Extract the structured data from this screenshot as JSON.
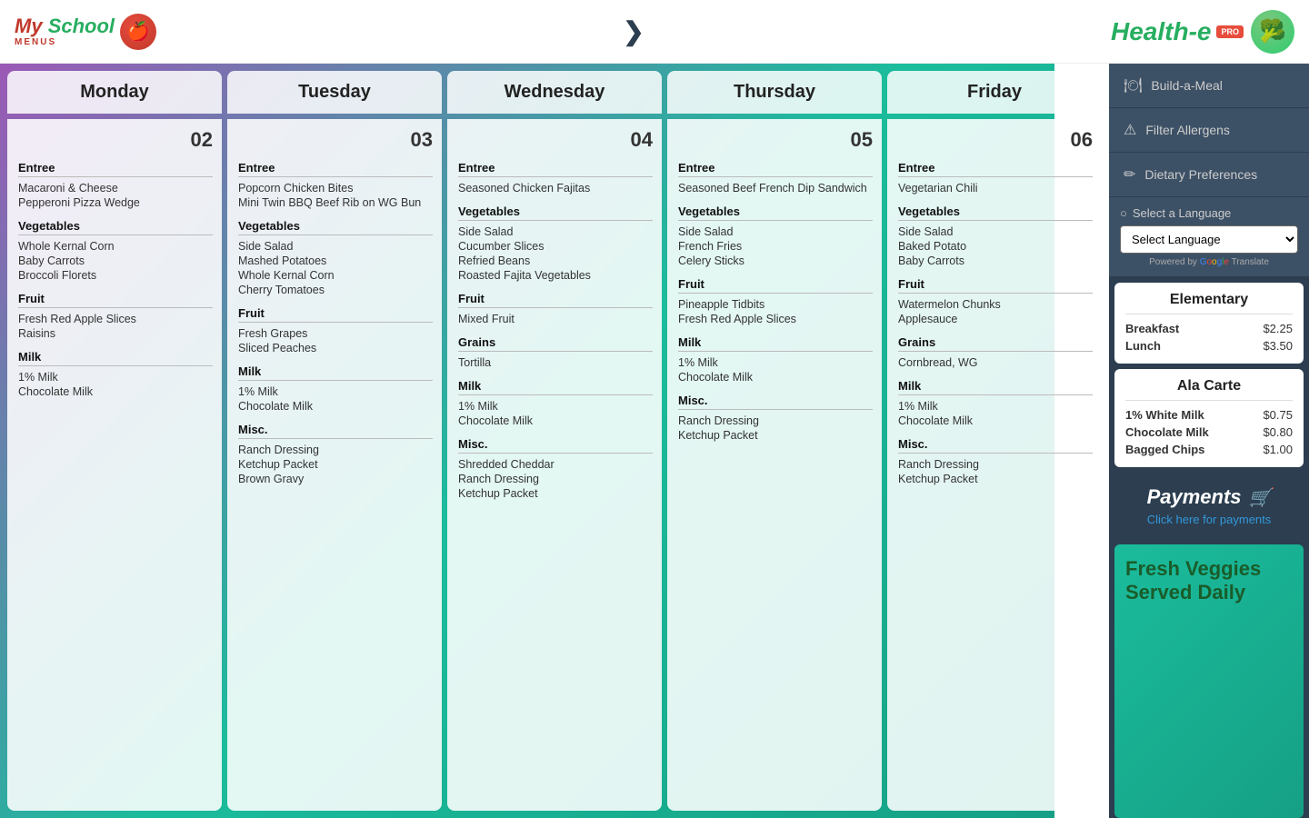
{
  "header": {
    "logo_left": "My School",
    "logo_sub": "MENUS",
    "logo_right_1": "Health",
    "logo_right_e": "e",
    "logo_right_bro": "BRo",
    "pro_badge": "PRO",
    "chevron": "❯"
  },
  "days": [
    {
      "name": "Monday",
      "num": "02",
      "sections": [
        {
          "title": "Entree",
          "items": [
            "Macaroni & Cheese",
            "Pepperoni Pizza Wedge"
          ]
        },
        {
          "title": "Vegetables",
          "items": [
            "Whole Kernal Corn",
            "Baby Carrots",
            "Broccoli Florets"
          ]
        },
        {
          "title": "Fruit",
          "items": [
            "Fresh Red Apple Slices",
            "Raisins"
          ]
        },
        {
          "title": "Milk",
          "items": [
            "1% Milk",
            "Chocolate Milk"
          ]
        }
      ]
    },
    {
      "name": "Tuesday",
      "num": "03",
      "sections": [
        {
          "title": "Entree",
          "items": [
            "Popcorn Chicken Bites",
            "Mini Twin BBQ Beef Rib on WG Bun"
          ]
        },
        {
          "title": "Vegetables",
          "items": [
            "Side Salad",
            "Mashed Potatoes",
            "Whole Kernal Corn",
            "Cherry Tomatoes"
          ]
        },
        {
          "title": "Fruit",
          "items": [
            "Fresh Grapes",
            "Sliced Peaches"
          ]
        },
        {
          "title": "Milk",
          "items": [
            "1% Milk",
            "Chocolate Milk"
          ]
        },
        {
          "title": "Misc.",
          "items": [
            "Ranch Dressing",
            "Ketchup Packet",
            "Brown Gravy"
          ]
        }
      ]
    },
    {
      "name": "Wednesday",
      "num": "04",
      "sections": [
        {
          "title": "Entree",
          "items": [
            "Seasoned Chicken Fajitas"
          ]
        },
        {
          "title": "Vegetables",
          "items": [
            "Side Salad",
            "Cucumber Slices",
            "Refried Beans",
            "Roasted Fajita Vegetables"
          ]
        },
        {
          "title": "Fruit",
          "items": [
            "Mixed Fruit"
          ]
        },
        {
          "title": "Grains",
          "items": [
            "Tortilla"
          ]
        },
        {
          "title": "Milk",
          "items": [
            "1% Milk",
            "Chocolate Milk"
          ]
        },
        {
          "title": "Misc.",
          "items": [
            "Shredded Cheddar",
            "Ranch Dressing",
            "Ketchup Packet"
          ]
        }
      ]
    },
    {
      "name": "Thursday",
      "num": "05",
      "sections": [
        {
          "title": "Entree",
          "items": [
            "Seasoned Beef French Dip Sandwich"
          ]
        },
        {
          "title": "Vegetables",
          "items": [
            "Side Salad",
            "French Fries",
            "Celery Sticks"
          ]
        },
        {
          "title": "Fruit",
          "items": [
            "Pineapple Tidbits",
            "Fresh Red Apple Slices"
          ]
        },
        {
          "title": "Milk",
          "items": [
            "1% Milk",
            "Chocolate Milk"
          ]
        },
        {
          "title": "Misc.",
          "items": [
            "Ranch Dressing",
            "Ketchup Packet"
          ]
        }
      ]
    },
    {
      "name": "Friday",
      "num": "06",
      "sections": [
        {
          "title": "Entree",
          "items": [
            "Vegetarian Chili"
          ]
        },
        {
          "title": "Vegetables",
          "items": [
            "Side Salad",
            "Baked Potato",
            "Baby Carrots"
          ]
        },
        {
          "title": "Fruit",
          "items": [
            "Watermelon Chunks",
            "Applesauce"
          ]
        },
        {
          "title": "Grains",
          "items": [
            "Cornbread, WG"
          ]
        },
        {
          "title": "Milk",
          "items": [
            "1% Milk",
            "Chocolate Milk"
          ]
        },
        {
          "title": "Misc.",
          "items": [
            "Ranch Dressing",
            "Ketchup Packet"
          ]
        }
      ]
    }
  ],
  "sidebar": {
    "build_meal": "Build-a-Meal",
    "filter_allergens": "Filter Allergens",
    "dietary_prefs": "Dietary Preferences",
    "select_lang_label": "Select a Language",
    "select_lang_placeholder": "Select Language",
    "powered_by": "Powered by",
    "google_translate": "Google Translate",
    "elementary_title": "Elementary",
    "breakfast_label": "Breakfast",
    "breakfast_price": "$2.25",
    "lunch_label": "Lunch",
    "lunch_price": "$3.50",
    "ala_carte_title": "Ala Carte",
    "ala_carte_items": [
      {
        "label": "1% White Milk",
        "price": "$0.75"
      },
      {
        "label": "Chocolate Milk",
        "price": "$0.80"
      },
      {
        "label": "Bagged Chips",
        "price": "$1.00"
      }
    ],
    "payments_title": "Payments",
    "payments_link": "Click here for payments",
    "veggies_title": "Fresh Veggies",
    "veggies_sub": "Served Daily"
  }
}
